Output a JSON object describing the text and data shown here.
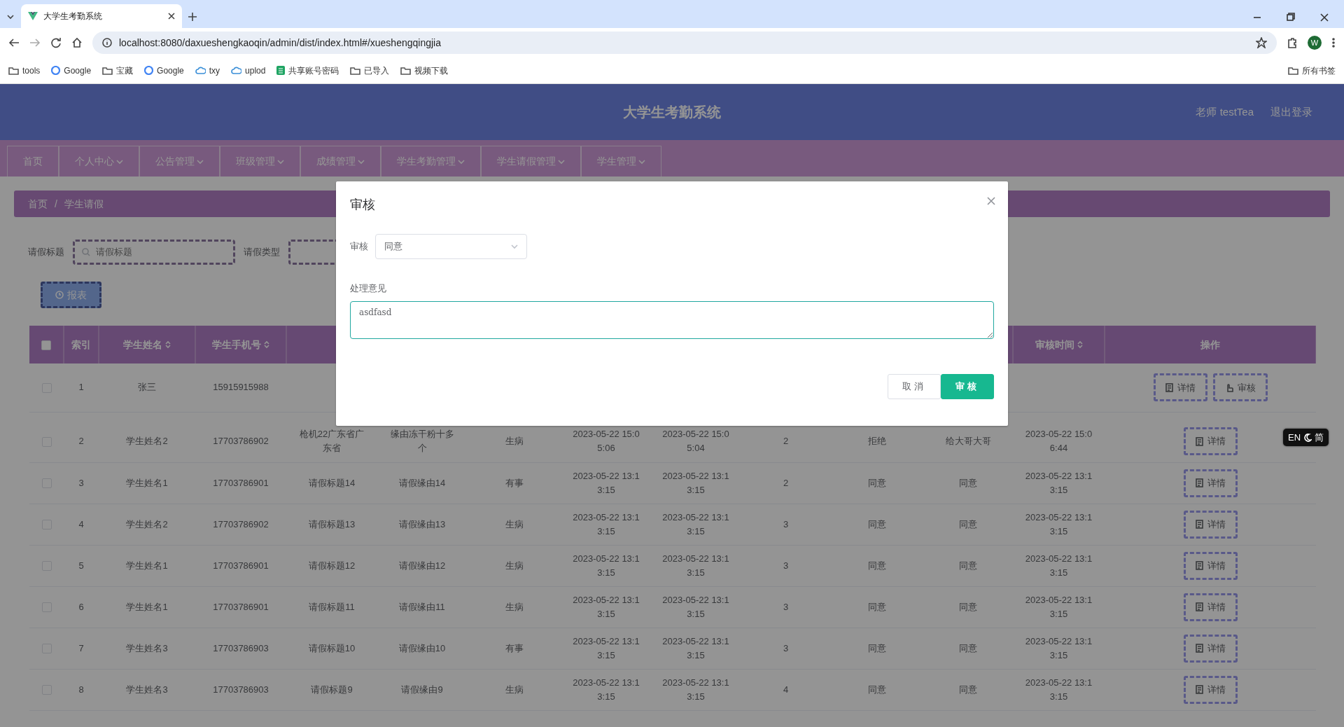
{
  "browser": {
    "tab": {
      "title": "大学生考勤系统"
    },
    "url": "localhost:8080/daxueshengkaoqin/admin/dist/index.html#/xueshengqingjia",
    "profile": "W",
    "bookmarks": [
      {
        "kind": "folder",
        "label": "tools"
      },
      {
        "kind": "google",
        "label": "Google"
      },
      {
        "kind": "folder",
        "label": "宝藏"
      },
      {
        "kind": "google",
        "label": "Google"
      },
      {
        "kind": "cloud",
        "label": "txy"
      },
      {
        "kind": "cloud",
        "label": "uplod"
      },
      {
        "kind": "sheet",
        "label": "共享账号密码"
      },
      {
        "kind": "folder",
        "label": "已导入"
      },
      {
        "kind": "folder",
        "label": "视频下载"
      }
    ],
    "all_bookmarks": "所有书签"
  },
  "app": {
    "title": "大学生考勤系统",
    "user": "老师 testTea",
    "logout": "退出登录"
  },
  "nav": [
    {
      "label": "首页",
      "dropdown": false
    },
    {
      "label": "个人中心",
      "dropdown": true
    },
    {
      "label": "公告管理",
      "dropdown": true
    },
    {
      "label": "班级管理",
      "dropdown": true
    },
    {
      "label": "成绩管理",
      "dropdown": true
    },
    {
      "label": "学生考勤管理",
      "dropdown": true
    },
    {
      "label": "学生请假管理",
      "dropdown": true
    },
    {
      "label": "学生管理",
      "dropdown": true
    }
  ],
  "breadcrumb": [
    "首页",
    "学生请假"
  ],
  "breadcrumb_separator": "/",
  "search": {
    "fields": [
      {
        "kind": "input",
        "label": "请假标题",
        "placeholder": "请假标题"
      },
      {
        "kind": "select",
        "label": "请假类型"
      }
    ],
    "report_button": "报表"
  },
  "table": {
    "select_all": {
      "checked": false
    },
    "columns": [
      {
        "label": "索引",
        "sortable": false
      },
      {
        "label": "学生姓名",
        "sortable": true
      },
      {
        "label": "学生手机号",
        "sortable": true
      },
      {},
      {},
      {},
      {},
      {},
      {},
      {},
      {},
      {
        "label": "审核时间",
        "sortable": true
      },
      {
        "label": "操作",
        "sortable": false
      }
    ],
    "rows": [
      {
        "checked": false,
        "cells": [
          "1",
          "张三",
          "15915915988",
          null,
          null,
          null,
          null,
          null,
          null,
          null,
          null,
          null
        ],
        "actions": [
          "详情",
          "审核"
        ]
      },
      {
        "checked": false,
        "cells": [
          "2",
          "学生姓名2",
          "17703786902",
          "枪机22广东省广东省",
          "缘由冻干粉十多个",
          "生病",
          "2023-05-22 15:05:06",
          "2023-05-22 15:05:04",
          "2",
          "拒绝",
          "给大哥大哥",
          "2023-05-22 15:06:44"
        ],
        "actions": [
          "详情"
        ]
      },
      {
        "checked": false,
        "cells": [
          "3",
          "学生姓名1",
          "17703786901",
          "请假标题14",
          "请假缘由14",
          "有事",
          "2023-05-22 13:13:15",
          "2023-05-22 13:13:15",
          "2",
          "同意",
          "同意",
          "2023-05-22 13:13:15"
        ],
        "actions": [
          "详情"
        ]
      },
      {
        "checked": false,
        "cells": [
          "4",
          "学生姓名2",
          "17703786902",
          "请假标题13",
          "请假缘由13",
          "生病",
          "2023-05-22 13:13:15",
          "2023-05-22 13:13:15",
          "3",
          "同意",
          "同意",
          "2023-05-22 13:13:15"
        ],
        "actions": [
          "详情"
        ]
      },
      {
        "checked": false,
        "cells": [
          "5",
          "学生姓名1",
          "17703786901",
          "请假标题12",
          "请假缘由12",
          "生病",
          "2023-05-22 13:13:15",
          "2023-05-22 13:13:15",
          "3",
          "同意",
          "同意",
          "2023-05-22 13:13:15"
        ],
        "actions": [
          "详情"
        ]
      },
      {
        "checked": false,
        "cells": [
          "6",
          "学生姓名1",
          "17703786901",
          "请假标题11",
          "请假缘由11",
          "生病",
          "2023-05-22 13:13:15",
          "2023-05-22 13:13:15",
          "3",
          "同意",
          "同意",
          "2023-05-22 13:13:15"
        ],
        "actions": [
          "详情"
        ]
      },
      {
        "checked": false,
        "cells": [
          "7",
          "学生姓名3",
          "17703786903",
          "请假标题10",
          "请假缘由10",
          "有事",
          "2023-05-22 13:13:15",
          "2023-05-22 13:13:15",
          "3",
          "同意",
          "同意",
          "2023-05-22 13:13:15"
        ],
        "actions": [
          "详情"
        ]
      },
      {
        "checked": false,
        "cells": [
          "8",
          "学生姓名3",
          "17703786903",
          "请假标题9",
          "请假缘由9",
          "生病",
          "2023-05-22 13:13:15",
          "2023-05-22 13:13:15",
          "4",
          "同意",
          "同意",
          "2023-05-22 13:13:15"
        ],
        "actions": [
          "详情"
        ]
      }
    ]
  },
  "modal": {
    "title": "审核",
    "fields": [
      {
        "kind": "select",
        "label": "审核",
        "value": "同意"
      },
      {
        "kind": "textarea",
        "label": "处理意见",
        "value": "asdfasd"
      }
    ],
    "buttons": [
      {
        "kind": "default",
        "label": "取消"
      },
      {
        "kind": "primary",
        "label": "审核"
      }
    ]
  },
  "lang_toggle": {
    "left": "EN",
    "right": "简"
  }
}
